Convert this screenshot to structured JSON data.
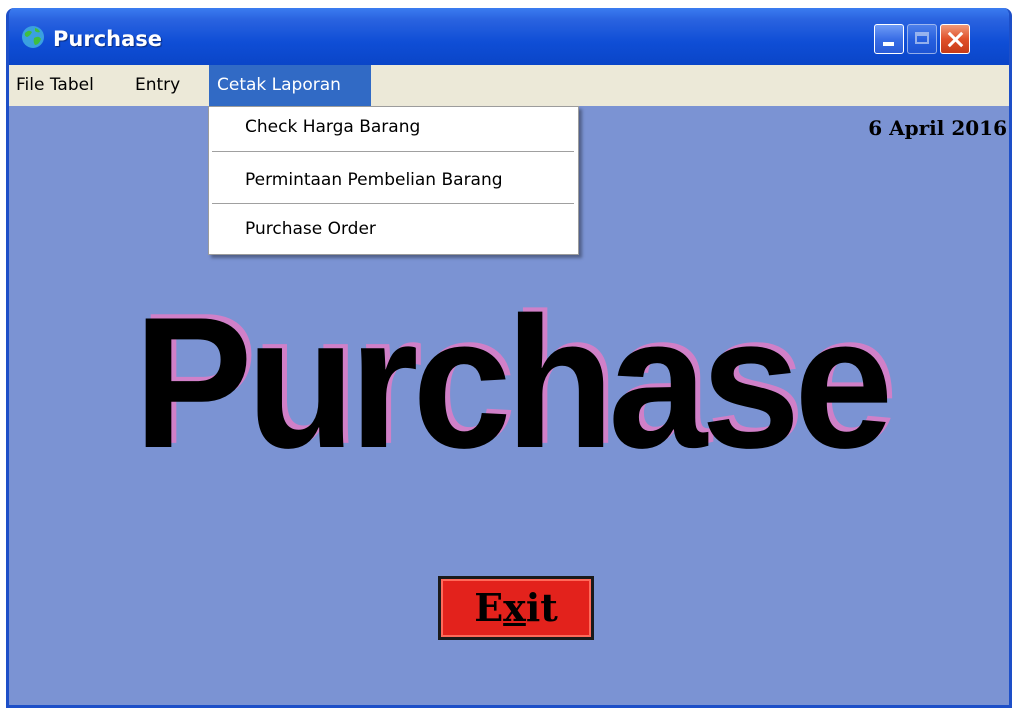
{
  "window": {
    "title": "Purchase",
    "app_icon": "globe-icon",
    "buttons": {
      "minimize": "minimize-icon",
      "maximize": "maximize-icon",
      "close": "close-icon"
    }
  },
  "menubar": {
    "items": [
      {
        "label": "File Tabel"
      },
      {
        "label": "Entry"
      },
      {
        "label": "Cetak Laporan",
        "active": true
      }
    ]
  },
  "dropdown": {
    "items": [
      {
        "label": "Check Harga Barang"
      },
      {
        "label": "Permintaan Pembelian Barang"
      },
      {
        "label": "Purchase Order"
      }
    ]
  },
  "main": {
    "date": "6 April 2016",
    "banner": "Purchase",
    "exit_button": {
      "prefix": "E",
      "mnemonic": "x",
      "suffix": "it"
    }
  },
  "colors": {
    "background": "#7b93d3",
    "titlebar": "#0f4ed6",
    "menu_highlight": "#316ac5",
    "banner_shadow": "#d080c8",
    "exit_button": "#e3221c"
  }
}
